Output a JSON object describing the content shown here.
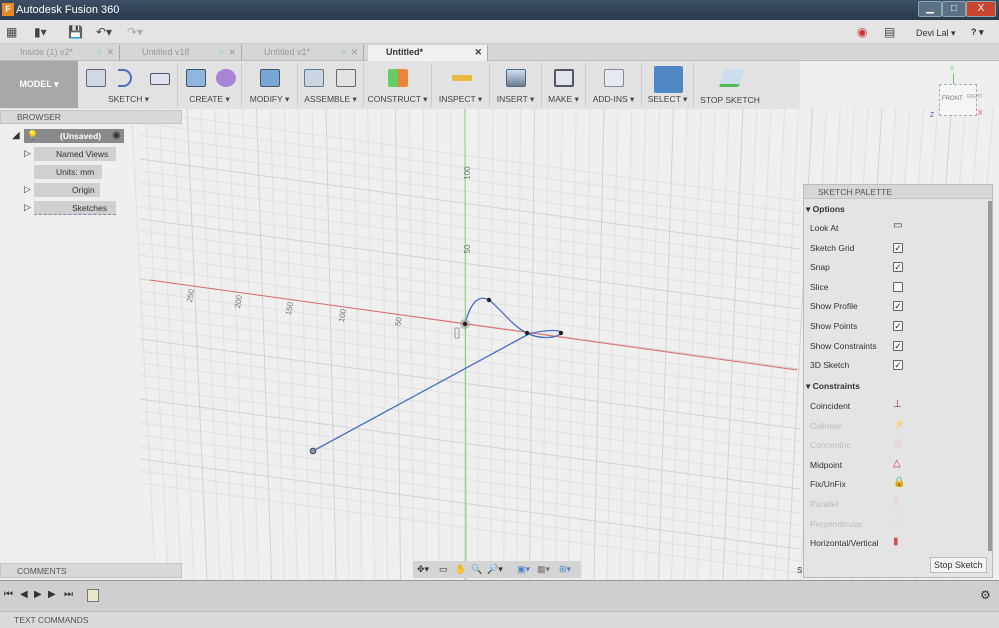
{
  "window": {
    "title": "Autodesk Fusion 360",
    "minimize": "▁",
    "maximize": "□",
    "close": "X"
  },
  "quickbar": {
    "user": "Devi Lal ▾",
    "help": "? ▾"
  },
  "tabs": [
    {
      "label": "Inside (1) v2*"
    },
    {
      "label": "Untitled v18"
    },
    {
      "label": "Untitled v1*"
    },
    {
      "label": "Untitled*",
      "active": true
    }
  ],
  "ribbon": {
    "workspace": "MODEL ▾",
    "groups": [
      "SKETCH ▾",
      "CREATE ▾",
      "MODIFY ▾",
      "ASSEMBLE ▾",
      "CONSTRUCT ▾",
      "INSPECT ▾",
      "INSERT ▾",
      "MAKE ▾",
      "ADD-INS ▾",
      "SELECT ▾",
      "STOP SKETCH"
    ]
  },
  "browser": {
    "title": "BROWSER",
    "root": "(Unsaved)",
    "items": [
      "Named Views",
      "Units: mm",
      "Origin",
      "Sketches"
    ]
  },
  "viewport": {
    "x_ticks": [
      "250",
      "200",
      "150",
      "100",
      "50"
    ],
    "y_ticks": [
      "100",
      "50"
    ],
    "viewcube": {
      "front": "FRONT",
      "right": "RIGHT",
      "x": "X",
      "y": "Y",
      "z": "Z"
    }
  },
  "palette": {
    "title": "SKETCH PALETTE",
    "options_title": "Options",
    "options": [
      {
        "label": "Look At",
        "type": "button"
      },
      {
        "label": "Sketch Grid",
        "checked": true
      },
      {
        "label": "Snap",
        "checked": true
      },
      {
        "label": "Slice",
        "checked": false
      },
      {
        "label": "Show Profile",
        "checked": true
      },
      {
        "label": "Show Points",
        "checked": true
      },
      {
        "label": "Show Constraints",
        "checked": true
      },
      {
        "label": "3D Sketch",
        "checked": true
      }
    ],
    "constraints_title": "Constraints",
    "constraints": [
      {
        "label": "Coincident",
        "enabled": true,
        "icon": "coincident-icon",
        "glyph": "⊥"
      },
      {
        "label": "Colinear",
        "enabled": false,
        "icon": "colinear-icon",
        "glyph": "⚡"
      },
      {
        "label": "Concentric",
        "enabled": false,
        "icon": "concentric-icon",
        "glyph": "◎"
      },
      {
        "label": "Midpoint",
        "enabled": true,
        "icon": "midpoint-icon",
        "glyph": "△"
      },
      {
        "label": "Fix/UnFix",
        "enabled": true,
        "icon": "lock-icon",
        "glyph": "🔒"
      },
      {
        "label": "Parallel",
        "enabled": false,
        "icon": "parallel-icon",
        "glyph": "//"
      },
      {
        "label": "Perpendicular",
        "enabled": false,
        "icon": "perpendicular-icon",
        "glyph": "✓"
      },
      {
        "label": "Horizontal/Vertical",
        "enabled": true,
        "icon": "horizontal-vertical-icon",
        "glyph": "▮"
      }
    ],
    "stop_button": "Stop Sketch"
  },
  "comments": {
    "title": "COMMENTS"
  },
  "textcommands": {
    "title": "TEXT COMMANDS"
  },
  "colors": {
    "x_axis": "#e06a6a",
    "y_axis": "#7fd67f",
    "sketch": "#4a6ec0",
    "select_active": "#4e87c4"
  }
}
